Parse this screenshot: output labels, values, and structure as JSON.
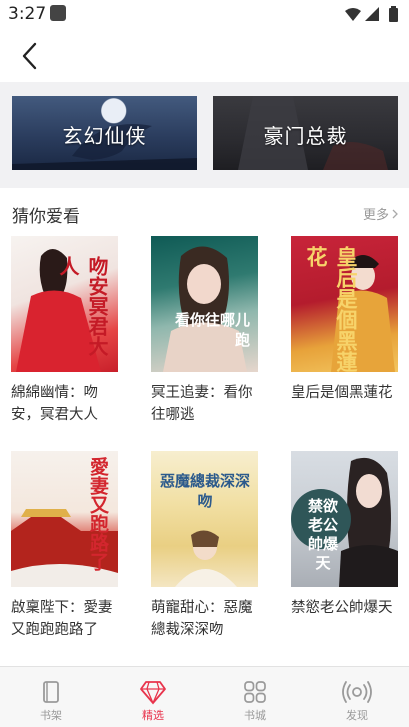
{
  "status_bar": {
    "time": "3:27"
  },
  "nav": {
    "back_icon": "chevron-left-icon"
  },
  "banners": [
    {
      "label": "玄幻仙侠"
    },
    {
      "label": "豪门总裁"
    }
  ],
  "section": {
    "title": "猜你爱看",
    "more_label": "更多"
  },
  "books": [
    {
      "title": "綿綿幽情：吻安，冥君大人",
      "cover_text": "吻安冥君大人"
    },
    {
      "title": "冥王追妻：看你往哪逃",
      "cover_text": "看你往哪儿跑"
    },
    {
      "title": "皇后是個黑蓮花",
      "cover_text": "皇后是個黑蓮花"
    },
    {
      "title": "啟稟陛下：愛妻又跑跑跑路了",
      "cover_text": "愛妻又跑路了"
    },
    {
      "title": "萌寵甜心：惡魔總裁深深吻",
      "cover_text": "惡魔總裁深深吻"
    },
    {
      "title": "禁慾老公帥爆天",
      "cover_text": "禁欲老公帥爆天"
    }
  ],
  "tabs": [
    {
      "label": "书架",
      "icon": "bookshelf-icon"
    },
    {
      "label": "精选",
      "icon": "diamond-icon",
      "active": true
    },
    {
      "label": "书城",
      "icon": "grid-icon"
    },
    {
      "label": "发现",
      "icon": "radar-icon"
    }
  ],
  "colors": {
    "accent": "#e8344c",
    "inactive": "#9a9a9a"
  }
}
